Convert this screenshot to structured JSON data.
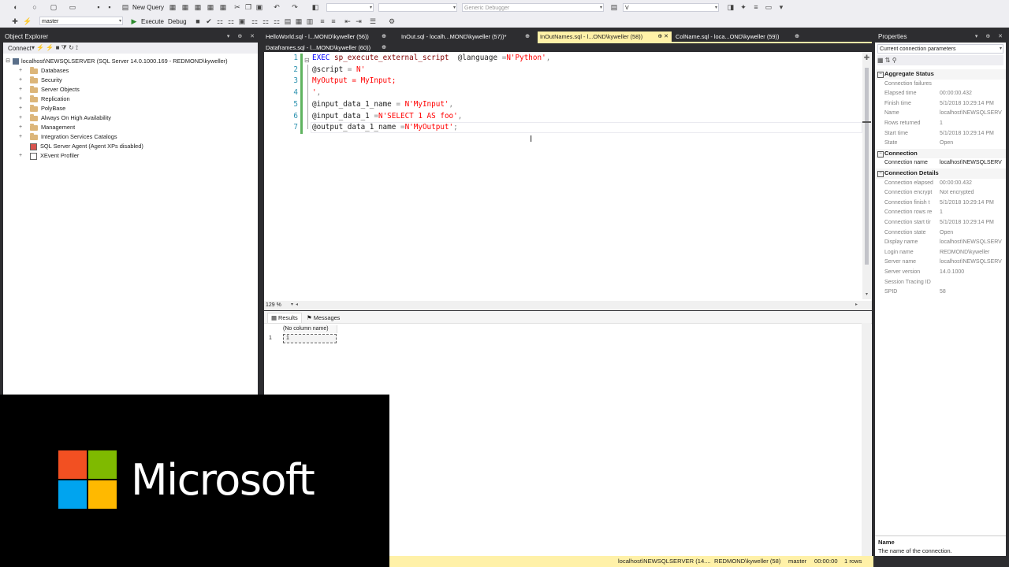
{
  "toolbar": {
    "new_query": "New Query",
    "database": "master",
    "execute": "Execute",
    "debug": "Debug",
    "debugger": "Generic Debugger",
    "search_value": "V"
  },
  "object_explorer": {
    "title": "Object Explorer",
    "connect": "Connect",
    "server": "localhost\\NEWSQLSERVER (SQL Server 14.0.1000.169 - REDMOND\\kyweller)",
    "items": [
      {
        "label": "Databases",
        "icon": "folder-icon",
        "expand": "+"
      },
      {
        "label": "Security",
        "icon": "folder-icon",
        "expand": "+"
      },
      {
        "label": "Server Objects",
        "icon": "folder-icon",
        "expand": "+"
      },
      {
        "label": "Replication",
        "icon": "folder-icon",
        "expand": "+"
      },
      {
        "label": "PolyBase",
        "icon": "folder-icon",
        "expand": "+"
      },
      {
        "label": "Always On High Availability",
        "icon": "folder-icon",
        "expand": "+"
      },
      {
        "label": "Management",
        "icon": "folder-icon",
        "expand": "+"
      },
      {
        "label": "Integration Services Catalogs",
        "icon": "folder-icon",
        "expand": "+"
      },
      {
        "label": "SQL Server Agent (Agent XPs disabled)",
        "icon": "agent-icon",
        "expand": ""
      },
      {
        "label": "XEvent Profiler",
        "icon": "xevent-icon",
        "expand": "+"
      }
    ]
  },
  "tabs": [
    {
      "label": "HelloWorld.sql - l...MOND\\kyweller (56))",
      "pin": "⊕"
    },
    {
      "label": "InOut.sql - localh...MOND\\kyweller (57))*",
      "pin": "⊕"
    },
    {
      "label": "InOutNames.sql - l...OND\\kyweller (58))",
      "pin": "⊕ ✕"
    },
    {
      "label": "ColName.sql - loca...OND\\kyweller (59))",
      "pin": "⊕"
    },
    {
      "label": "Dataframes.sql - l...MOND\\kyweller (60))",
      "pin": "⊕"
    }
  ],
  "editor": {
    "line_numbers": [
      "1",
      "2",
      "3",
      "4",
      "5",
      "6",
      "7"
    ],
    "lines": [
      [
        {
          "t": "EXEC ",
          "c": "kw"
        },
        {
          "t": "sp_execute_external_script",
          "c": "fn"
        },
        {
          "t": "  @language ",
          "c": "var"
        },
        {
          "t": "=",
          "c": "op"
        },
        {
          "t": "N'Python'",
          "c": "str"
        },
        {
          "t": ",",
          "c": "op"
        }
      ],
      [
        {
          "t": "@script ",
          "c": "var"
        },
        {
          "t": "= ",
          "c": "op"
        },
        {
          "t": "N'",
          "c": "str"
        }
      ],
      [
        {
          "t": "MyOutput = MyInput;",
          "c": "str"
        }
      ],
      [
        {
          "t": "'",
          "c": "str"
        },
        {
          "t": ",",
          "c": "op"
        }
      ],
      [
        {
          "t": "@input_data_1_name ",
          "c": "var"
        },
        {
          "t": "= ",
          "c": "op"
        },
        {
          "t": "N'MyInput'",
          "c": "str"
        },
        {
          "t": ",",
          "c": "op"
        }
      ],
      [
        {
          "t": "@input_data_1 ",
          "c": "var"
        },
        {
          "t": "=",
          "c": "op"
        },
        {
          "t": "N'SELECT 1 AS foo'",
          "c": "str"
        },
        {
          "t": ",",
          "c": "op"
        }
      ],
      [
        {
          "t": "@output_data_1_name ",
          "c": "var"
        },
        {
          "t": "=",
          "c": "op"
        },
        {
          "t": "N'MyOutput'",
          "c": "str"
        },
        {
          "t": ";",
          "c": "op"
        }
      ]
    ],
    "zoom": "129 %"
  },
  "results": {
    "tab_results": "Results",
    "tab_messages": "Messages",
    "column_header": "(No column name)",
    "row_number": "1",
    "cell_value": "1"
  },
  "properties": {
    "title": "Properties",
    "selector": "Current connection parameters",
    "categories": [
      {
        "name": "Aggregate Status",
        "rows": [
          {
            "k": "Connection failures",
            "v": ""
          },
          {
            "k": "Elapsed time",
            "v": "00:00:00.432"
          },
          {
            "k": "Finish time",
            "v": "5/1/2018 10:29:14 PM"
          },
          {
            "k": "Name",
            "v": "localhost\\NEWSQLSERV"
          },
          {
            "k": "Rows returned",
            "v": "1"
          },
          {
            "k": "Start time",
            "v": "5/1/2018 10:29:14 PM"
          },
          {
            "k": "State",
            "v": "Open"
          }
        ]
      },
      {
        "name": "Connection",
        "rows": [
          {
            "k": "Connection name",
            "v": "localhost\\NEWSQLSERV",
            "dark": true
          }
        ]
      },
      {
        "name": "Connection Details",
        "rows": [
          {
            "k": "Connection elapsed",
            "v": "00:00:00.432"
          },
          {
            "k": "Connection encrypt",
            "v": "Not encrypted"
          },
          {
            "k": "Connection finish t",
            "v": "5/1/2018 10:29:14 PM"
          },
          {
            "k": "Connection rows re",
            "v": "1"
          },
          {
            "k": "Connection start tir",
            "v": "5/1/2018 10:29:14 PM"
          },
          {
            "k": "Connection state",
            "v": "Open"
          },
          {
            "k": "Display name",
            "v": "localhost\\NEWSQLSERV"
          },
          {
            "k": "Login name",
            "v": "REDMOND\\kyweller"
          },
          {
            "k": "Server name",
            "v": "localhost\\NEWSQLSERV"
          },
          {
            "k": "Server version",
            "v": "14.0.1000"
          },
          {
            "k": "Session Tracing ID",
            "v": ""
          },
          {
            "k": "SPID",
            "v": "58"
          }
        ]
      }
    ],
    "desc_title": "Name",
    "desc_text": "The name of the connection."
  },
  "status_bar": {
    "server": "localhost\\NEWSQLSERVER (14....",
    "user": "REDMOND\\kyweller (58)",
    "database": "master",
    "elapsed": "00:00:00",
    "rows": "1 rows"
  },
  "logo": {
    "text": "Microsoft",
    "colors": [
      "#f25022",
      "#7fba00",
      "#00a4ef",
      "#ffb900"
    ]
  }
}
